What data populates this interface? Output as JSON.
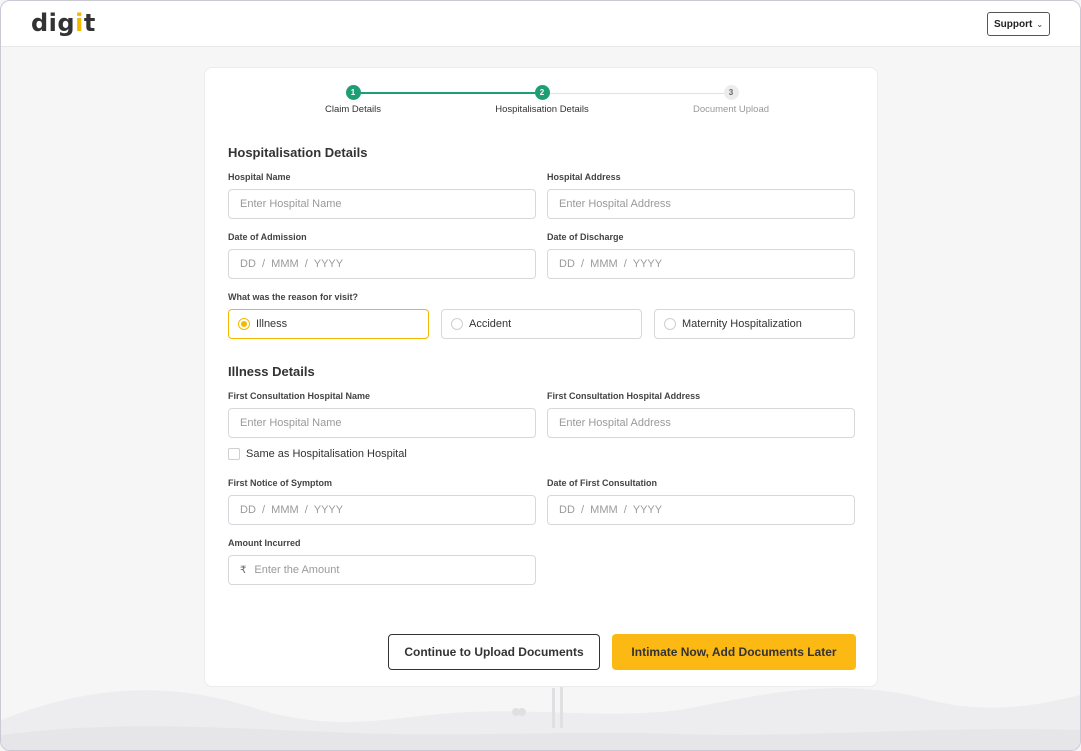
{
  "header": {
    "logo_text_main": "dig",
    "logo_text_accent": "i",
    "logo_text_end": "t",
    "support_label": "Support"
  },
  "stepper": {
    "steps": [
      {
        "number": "1",
        "label": "Claim Details",
        "state": "active"
      },
      {
        "number": "2",
        "label": "Hospitalisation Details",
        "state": "active"
      },
      {
        "number": "3",
        "label": "Document Upload",
        "state": "pending"
      }
    ]
  },
  "hospitalisation": {
    "title": "Hospitalisation Details",
    "hospital_name_label": "Hospital Name",
    "hospital_name_placeholder": "Enter Hospital Name",
    "hospital_address_label": "Hospital Address",
    "hospital_address_placeholder": "Enter Hospital Address",
    "admission_label": "Date of Admission",
    "admission_placeholder": "DD  /  MMM  /  YYYY",
    "discharge_label": "Date of Discharge",
    "discharge_placeholder": "DD  /  MMM  /  YYYY",
    "reason_label": "What was the reason for visit?",
    "reasons": [
      "Illness",
      "Accident",
      "Maternity Hospitalization"
    ],
    "selected_reason": "Illness"
  },
  "illness": {
    "title": "Illness Details",
    "first_hospital_label": "First Consultation Hospital Name",
    "first_hospital_placeholder": "Enter Hospital Name",
    "first_address_label": "First Consultation Hospital Address",
    "first_address_placeholder": "Enter Hospital Address",
    "same_as_label": "Same as Hospitalisation Hospital",
    "symptom_label": "First Notice of Symptom",
    "symptom_placeholder": "DD  /  MMM  /  YYYY",
    "consult_label": "Date of First Consultation",
    "consult_placeholder": "DD  /  MMM  /  YYYY",
    "amount_label": "Amount Incurred",
    "currency_symbol": "₹",
    "amount_placeholder": "Enter the Amount"
  },
  "actions": {
    "continue_label": "Continue to Upload Documents",
    "intimate_label": "Intimate Now, Add Documents Later"
  },
  "colors": {
    "accent": "#fdb913",
    "success": "#1e9e74"
  }
}
